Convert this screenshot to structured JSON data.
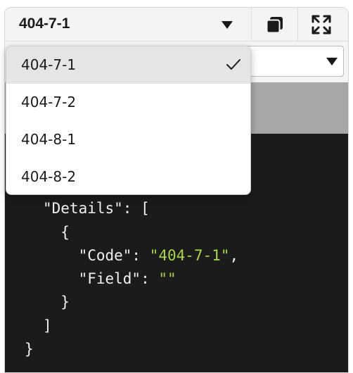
{
  "header": {
    "title": "404-7-1",
    "copy_icon": "copy-icon",
    "expand_icon": "expand-icon"
  },
  "dropdown": {
    "options": [
      {
        "label": "404-7-1",
        "selected": true
      },
      {
        "label": "404-7-2",
        "selected": false
      },
      {
        "label": "404-8-1",
        "selected": false
      },
      {
        "label": "404-8-2",
        "selected": false
      }
    ]
  },
  "code": {
    "lines": [
      {
        "pre": "\"Details\": [",
        "str": "",
        "post": ""
      },
      {
        "pre": "  {",
        "str": "",
        "post": ""
      },
      {
        "pre": "    \"Code\": ",
        "str": "\"404-7-1\"",
        "post": ","
      },
      {
        "pre": "    \"Field\": ",
        "str": "\"\"",
        "post": ""
      },
      {
        "pre": "  }",
        "str": "",
        "post": ""
      },
      {
        "pre": "]",
        "str": "",
        "post": ""
      },
      {
        "pre": "}",
        "str": "",
        "post": ""
      }
    ]
  },
  "colors": {
    "code_bg": "#1b1b1b",
    "string": "#a6d64a",
    "selected_bg": "#e6e5e3"
  }
}
